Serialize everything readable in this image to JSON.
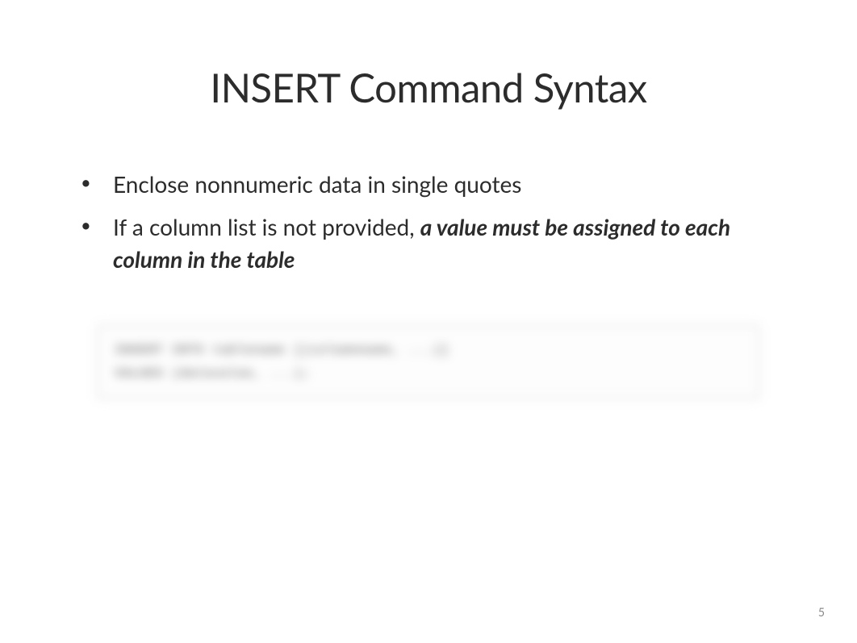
{
  "title": "INSERT Command Syntax",
  "bullets": [
    {
      "text": "Enclose nonnumeric data in single quotes",
      "emphasis": null
    },
    {
      "text": "If a column list is not provided, ",
      "emphasis": "a value must be assigned to each column in the table"
    }
  ],
  "code": {
    "line1": "INSERT INTO tablename [(columnname, ...)]",
    "line2": "VALUES (datavalue, ...);"
  },
  "page_number": "5"
}
